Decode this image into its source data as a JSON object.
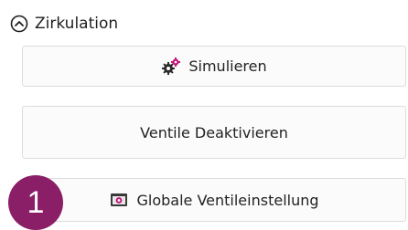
{
  "section": {
    "title": "Zirkulation",
    "collapse_icon": "chevron-up-circle-icon"
  },
  "buttons": {
    "simulieren": {
      "label": "Simulieren",
      "icon": "gears-icon"
    },
    "ventile_deaktivieren": {
      "label": "Ventile Deaktivieren"
    },
    "globale_ventileinstellung": {
      "label": "Globale Ventileinstellung",
      "icon": "valve-settings-icon"
    }
  },
  "step_badge": {
    "number": "1"
  },
  "colors": {
    "accent_magenta": "#c2187a",
    "badge": "#8a1e67",
    "button_border": "#dcdcdc"
  }
}
